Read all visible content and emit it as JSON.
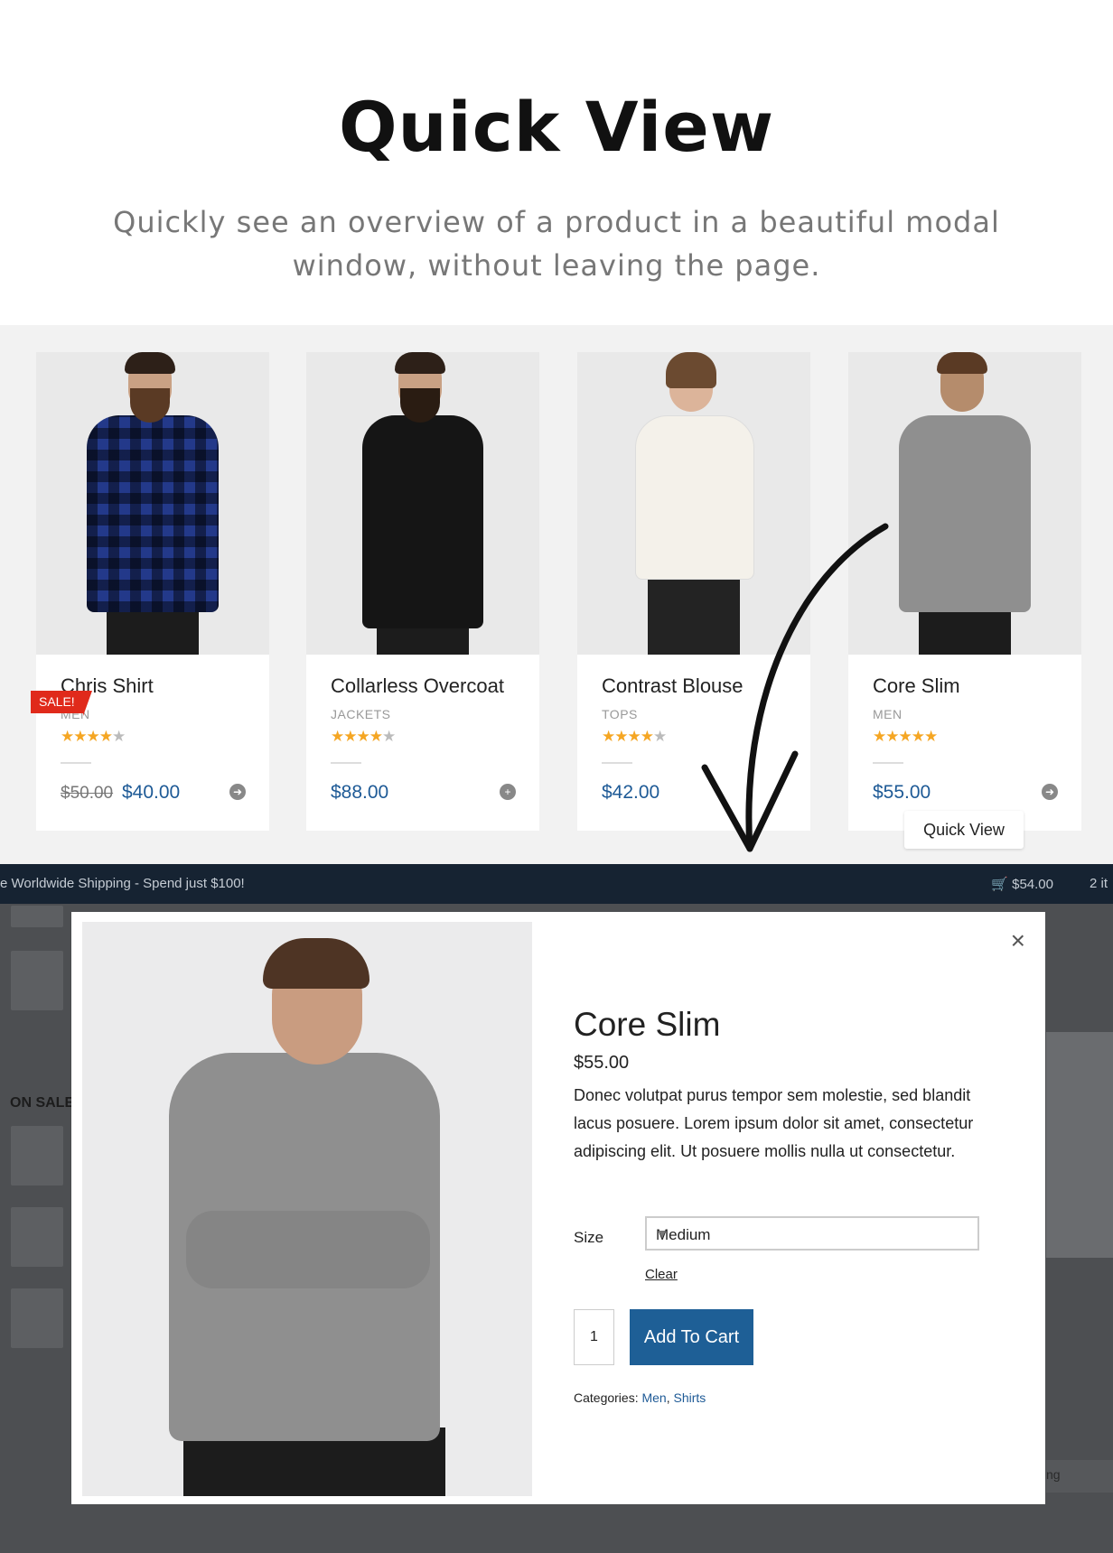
{
  "hero": {
    "title": "Quick View",
    "subtitle": "Quickly see an overview of a product in a beautiful modal window, without leaving the page."
  },
  "products": [
    {
      "name": "Chris Shirt",
      "category": "MEN",
      "stars": "★★★★",
      "stars_off": "★",
      "rating": 4.5,
      "old_price": "$50.00",
      "price": "$40.00",
      "badge": "SALE!",
      "shirt_color": "#23398a"
    },
    {
      "name": "Collarless Overcoat",
      "category": "JACKETS",
      "stars": "★★★★",
      "stars_off": "★",
      "rating": 4.5,
      "price": "$88.00",
      "shirt_color": "#151515"
    },
    {
      "name": "Contrast Blouse",
      "category": "TOPS",
      "stars": "★★★★",
      "stars_off": "★",
      "rating": 4.5,
      "price": "$42.00",
      "shirt_color": "#f4f1ea"
    },
    {
      "name": "Core Slim",
      "category": "MEN",
      "stars": "★★★★★",
      "stars_off": "",
      "rating": 5,
      "price": "$55.00",
      "shirt_color": "#8f8f8f"
    }
  ],
  "quick_view_button": "Quick View",
  "topbar": {
    "message": "e Worldwide Shipping - Spend just $100!",
    "cart_total": "$54.00",
    "items": "2 it"
  },
  "background": {
    "on_sale": "ON SALE",
    "footer_fragment": "ng"
  },
  "modal": {
    "title": "Core Slim",
    "price": "$55.00",
    "description": "Donec volutpat purus tempor sem molestie, sed blandit lacus posuere. Lorem ipsum dolor sit amet, consectetur adipiscing elit. Ut posuere mollis nulla ut consectetur.",
    "size_label": "Size",
    "size_value": "Medium",
    "clear_label": "Clear",
    "quantity": "1",
    "add_to_cart": "Add To Cart",
    "categories_label": "Categories:",
    "categories": [
      "Men",
      "Shirts"
    ],
    "close_icon": "×"
  },
  "colors": {
    "accent": "#1e5f96",
    "sale": "#e02a1b",
    "stars": "#f5a623",
    "topbar": "#162332"
  }
}
